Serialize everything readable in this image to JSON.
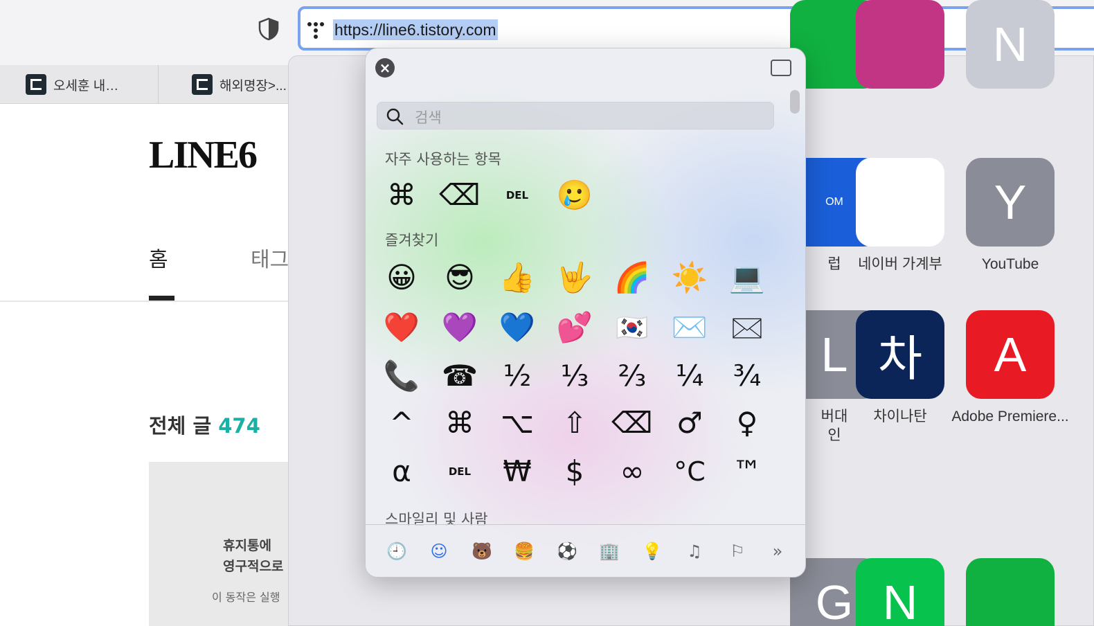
{
  "toolbar": {
    "url": "https://line6.tistory.com"
  },
  "tabs": [
    {
      "label": "오세훈 내…"
    },
    {
      "label": "해외명장>..."
    }
  ],
  "page": {
    "site_title": "LINE6",
    "nav_home": "홈",
    "nav_tag": "태그",
    "posts_label": "전체 글",
    "posts_count": "474",
    "thumb_line1": "휴지통에",
    "thumb_line2": "영구적으로",
    "thumb_line3": "이 동작은 실행"
  },
  "favorites": [
    {
      "label": "럽",
      "color": "#1a5fd9",
      "glyph": "OM"
    },
    {
      "label": "네이버 가계부",
      "color": "#ffffff",
      "glyph": ""
    },
    {
      "label": "YouTube",
      "color": "#8a8c97",
      "glyph": "Y"
    },
    {
      "label": "버대\n인",
      "color": "#8a8c97",
      "glyph": "L"
    },
    {
      "label": "차이나탄",
      "color": "#0c2558",
      "glyph": "차"
    },
    {
      "label": "Adobe Premiere...",
      "color": "#e81a24",
      "glyph": "A"
    },
    {
      "label": "",
      "color": "#8a8c97",
      "glyph": "G"
    },
    {
      "label": "",
      "color": "#07c24c",
      "glyph": "N"
    },
    {
      "label": "",
      "color": "#10b140",
      "glyph": ""
    },
    {
      "label": "",
      "color": "#10b140",
      "glyph": ""
    },
    {
      "label": "",
      "color": "#c13584",
      "glyph": ""
    },
    {
      "label": "",
      "color": "#c9cbd4",
      "glyph": "N"
    }
  ],
  "picker": {
    "search_placeholder": "검색",
    "frequent_title": "자주 사용하는 항목",
    "favorites_title": "즐겨찾기",
    "smileys_title": "스마일리 및 사람",
    "frequent": [
      "⌘",
      "⌫",
      "DEL",
      "🥲"
    ],
    "grid": [
      [
        "😀",
        "😎",
        "👍",
        "🤟",
        "🌈",
        "☀️",
        "💻"
      ],
      [
        "❤️",
        "💜",
        "💙",
        "💕",
        "🇰🇷",
        "✉️",
        "🖂"
      ],
      [
        "📞",
        "☎",
        "½",
        "⅓",
        "⅔",
        "¼",
        "¾"
      ],
      [
        "^",
        "⌘",
        "⌥",
        "⇧",
        "⌫",
        "♂",
        "♀"
      ],
      [
        "α",
        "DEL",
        "₩",
        "$",
        "∞",
        "°C",
        "™"
      ]
    ],
    "categories": [
      "🕘",
      "☺",
      "🐻",
      "🍔",
      "⚽",
      "🏢",
      "💡",
      "♫",
      "⚐",
      "»"
    ]
  }
}
